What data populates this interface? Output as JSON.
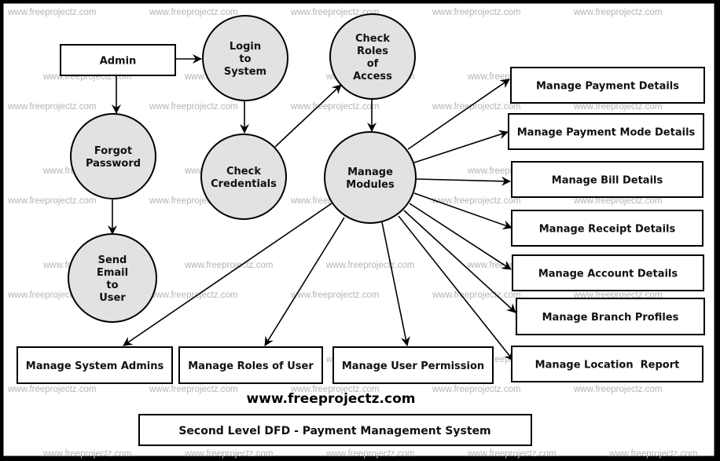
{
  "diagram": {
    "watermark_text": "www.freeprojectz.com",
    "site_url": "www.freeprojectz.com",
    "title": "Second Level DFD - Payment Management System",
    "colors": {
      "process_fill": "#e2e2e2",
      "entity_fill": "#ffffff",
      "stroke": "#000000",
      "watermark": "#b4b4b4"
    },
    "entities": [
      {
        "id": "admin",
        "label": [
          "Admin"
        ]
      },
      {
        "id": "payment",
        "label": [
          "Manage Payment Details"
        ]
      },
      {
        "id": "paymode",
        "label": [
          "Manage Payment Mode Details"
        ]
      },
      {
        "id": "bill",
        "label": [
          "Manage Bill Details"
        ]
      },
      {
        "id": "receipt",
        "label": [
          "Manage Receipt Details"
        ]
      },
      {
        "id": "account",
        "label": [
          "Manage Account Details"
        ]
      },
      {
        "id": "branch",
        "label": [
          "Manage Branch Profiles"
        ]
      },
      {
        "id": "location",
        "label": [
          "Manage Location  Report"
        ]
      },
      {
        "id": "sysadmins",
        "label": [
          "Manage System Admins"
        ]
      },
      {
        "id": "roles",
        "label": [
          "Manage Roles of User"
        ]
      },
      {
        "id": "perm",
        "label": [
          "Manage User Permission"
        ]
      }
    ],
    "processes": [
      {
        "id": "login",
        "label": [
          "Login",
          "to",
          "System"
        ]
      },
      {
        "id": "checkroles",
        "label": [
          "Check",
          "Roles",
          "of",
          "Access"
        ]
      },
      {
        "id": "forgot",
        "label": [
          "Forgot",
          "Password"
        ]
      },
      {
        "id": "checkcred",
        "label": [
          "Check",
          "Credentials"
        ]
      },
      {
        "id": "modules",
        "label": [
          "Manage",
          "Modules"
        ]
      },
      {
        "id": "sendemail",
        "label": [
          "Send",
          "Email",
          "to",
          "User"
        ]
      }
    ],
    "flows": [
      {
        "from": "admin",
        "to": "login"
      },
      {
        "from": "admin",
        "to": "forgot"
      },
      {
        "from": "forgot",
        "to": "sendemail"
      },
      {
        "from": "login",
        "to": "checkcred"
      },
      {
        "from": "checkcred",
        "to": "checkroles"
      },
      {
        "from": "checkroles",
        "to": "modules"
      },
      {
        "from": "modules",
        "to": "payment"
      },
      {
        "from": "modules",
        "to": "paymode"
      },
      {
        "from": "modules",
        "to": "bill"
      },
      {
        "from": "modules",
        "to": "receipt"
      },
      {
        "from": "modules",
        "to": "account"
      },
      {
        "from": "modules",
        "to": "branch"
      },
      {
        "from": "modules",
        "to": "location"
      },
      {
        "from": "modules",
        "to": "sysadmins"
      },
      {
        "from": "modules",
        "to": "roles"
      },
      {
        "from": "modules",
        "to": "perm"
      }
    ]
  }
}
